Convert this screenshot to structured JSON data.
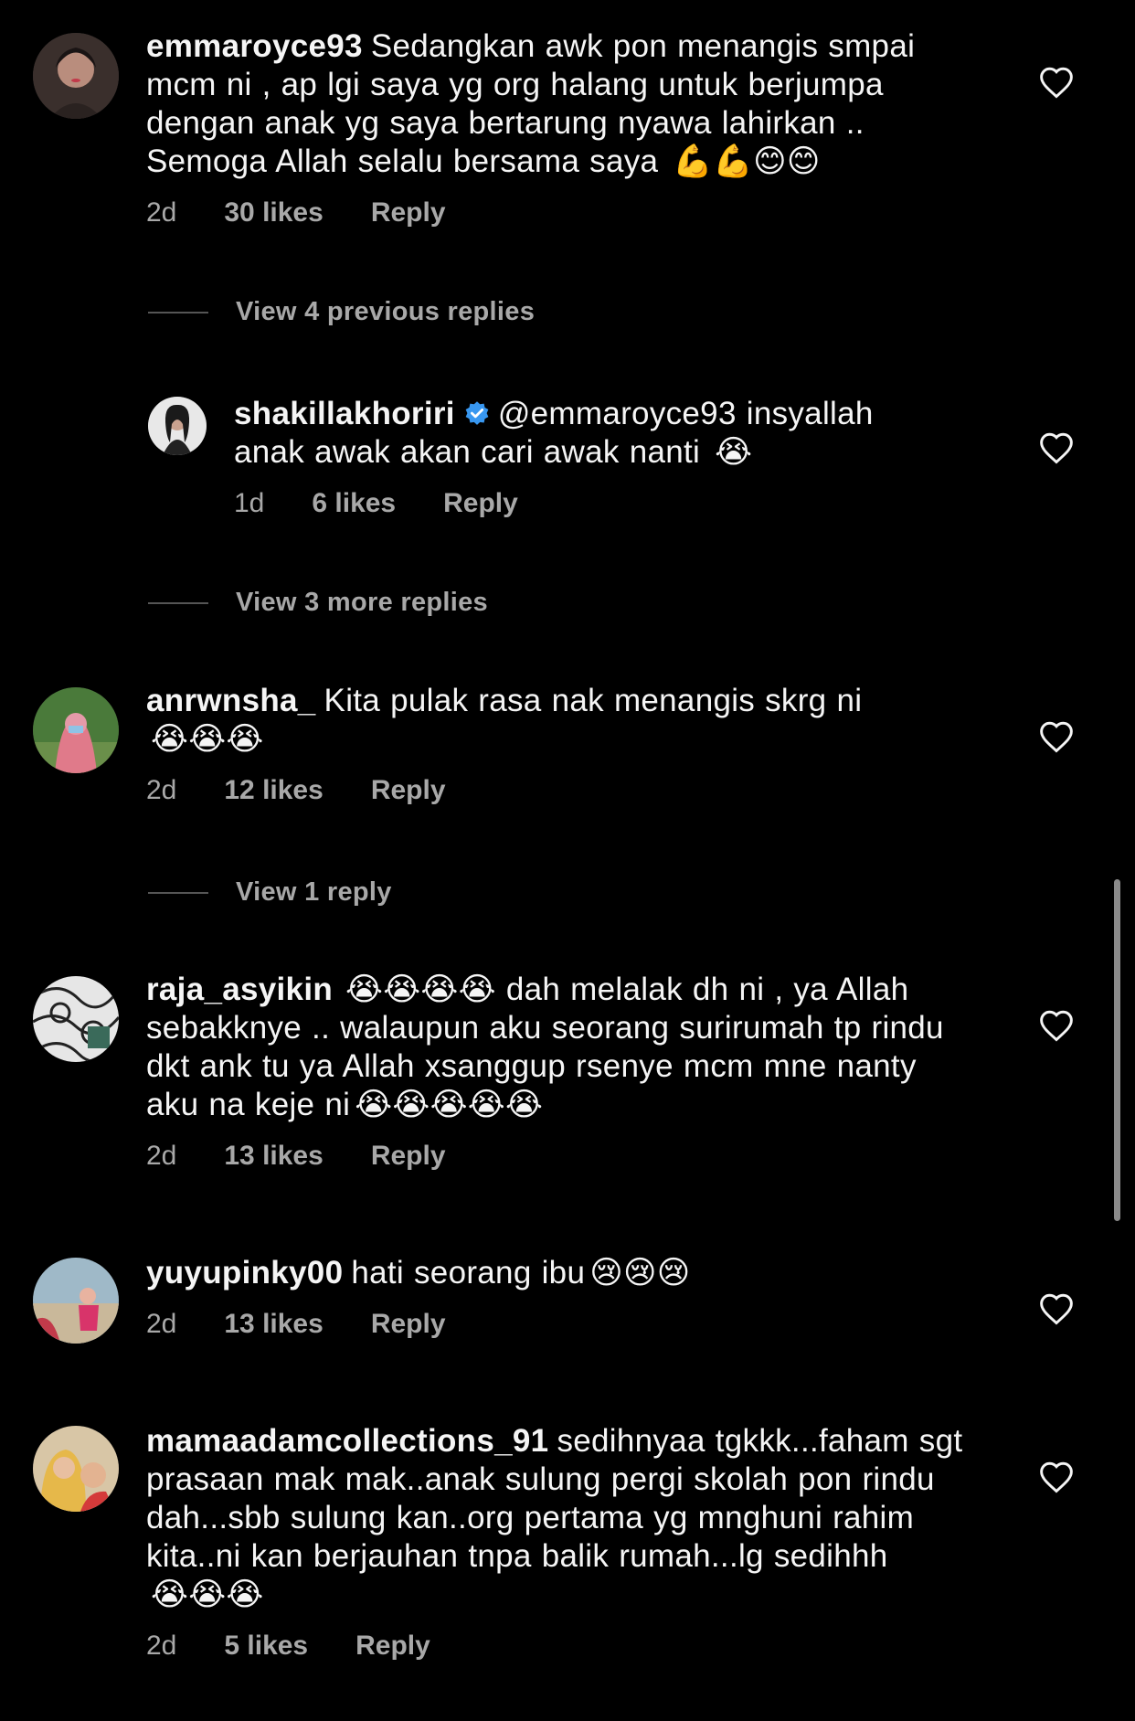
{
  "comments": [
    {
      "username": "emmaroyce93",
      "text": "Sedangkan awk pon menangis smpai mcm ni , ap lgi saya yg org halang untuk berjumpa dengan anak yg saya bertarung nyawa lahirkan .. Semoga Allah selalu bersama saya",
      "emojis": "💪💪😊😊",
      "time": "2d",
      "likes": "30 likes",
      "reply_label": "Reply"
    },
    {
      "username": "anrwnsha_",
      "text": "Kita pulak rasa nak menangis skrg ni",
      "emojis": "😭😭😭",
      "time": "2d",
      "likes": "12 likes",
      "reply_label": "Reply"
    },
    {
      "username": "raja_asyikin",
      "text_emojis_lead": "😭😭😭😭",
      "text": "dah melalak dh ni , ya Allah sebakknye .. walaupun aku seorang surirumah tp rindu dkt ank tu ya Allah xsanggup rsenye mcm mne nanty aku na keje ni",
      "emojis": "😭😭😭😭😭",
      "time": "2d",
      "likes": "13 likes",
      "reply_label": "Reply"
    },
    {
      "username": "yuyupinky00",
      "text": "hati seorang ibu",
      "emojis": "😢😢😢",
      "time": "2d",
      "likes": "13 likes",
      "reply_label": "Reply"
    },
    {
      "username": "mamaadamcollections_91",
      "text": "sedihnyaa tgkkk...faham sgt prasaan mak mak..anak sulung pergi skolah pon rindu dah...sbb sulung kan..org pertama yg mnghuni rahim kita..ni kan berjauhan tnpa balik rumah...lg sedihhh",
      "emojis": "😭😭😭",
      "time": "2d",
      "likes": "5 likes",
      "reply_label": "Reply"
    }
  ],
  "reply": {
    "username": "shakillakhoriri",
    "text": "@emmaroyce93 insyallah anak awak akan cari awak nanti",
    "emojis": "😭",
    "time": "1d",
    "likes": "6 likes",
    "reply_label": "Reply"
  },
  "threads": {
    "previous": "View 4 previous replies",
    "more": "View 3 more replies",
    "one": "View 1 reply"
  },
  "icons": {
    "heart": "heart-outline-icon",
    "verified": "verified-badge-icon"
  },
  "colors": {
    "background": "#000000",
    "text": "#f5f5f5",
    "secondary": "#a8a8a8",
    "verified": "#3897f0"
  }
}
